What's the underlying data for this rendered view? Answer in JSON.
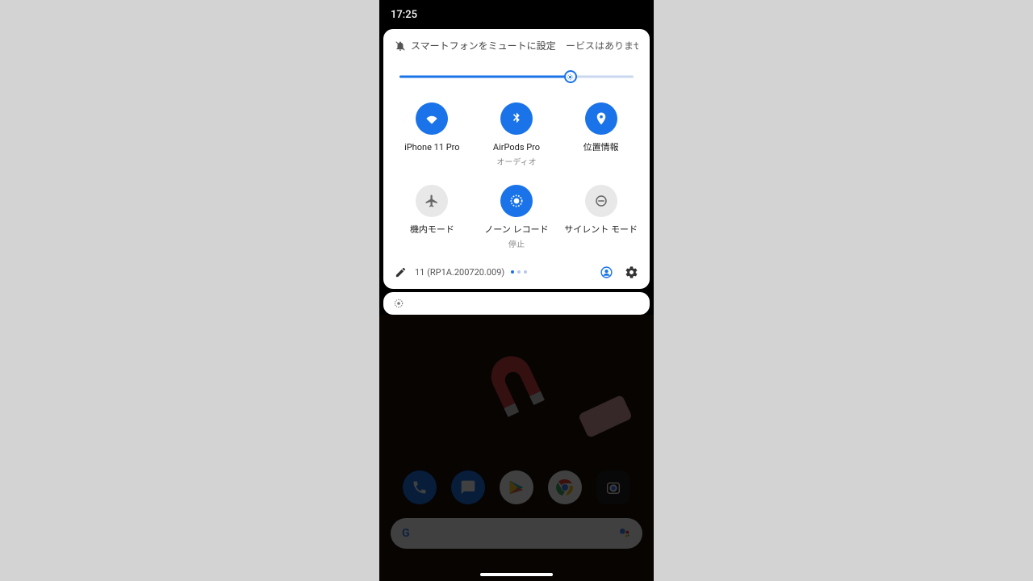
{
  "status": {
    "time": "17:25"
  },
  "header": {
    "mute_label": "スマートフォンをミュートに設定",
    "service_label": "ービスはありませ"
  },
  "brightness": {
    "percent": 73
  },
  "tiles": [
    {
      "id": "wifi",
      "label": "iPhone 11 Pro",
      "sublabel": "",
      "active": true,
      "icon": "wifi-icon"
    },
    {
      "id": "bluetooth",
      "label": "AirPods Pro",
      "sublabel": "オーディオ",
      "active": true,
      "icon": "bluetooth-icon"
    },
    {
      "id": "location",
      "label": "位置情報",
      "sublabel": "",
      "active": true,
      "icon": "location-icon"
    },
    {
      "id": "airplane",
      "label": "機内モード",
      "sublabel": "",
      "active": false,
      "icon": "airplane-icon"
    },
    {
      "id": "screenrec",
      "label": "ノーン レコード",
      "sublabel": "停止",
      "active": true,
      "icon": "record-icon"
    },
    {
      "id": "silent",
      "label": "サイレント モード",
      "sublabel": "",
      "active": false,
      "icon": "dnd-icon"
    }
  ],
  "footer": {
    "build": "11 (RP1A.200720.009)",
    "page_count": 3,
    "page_active": 0
  },
  "notification": {
    "icon": "record-icon"
  },
  "colors": {
    "accent": "#1a73e8"
  }
}
